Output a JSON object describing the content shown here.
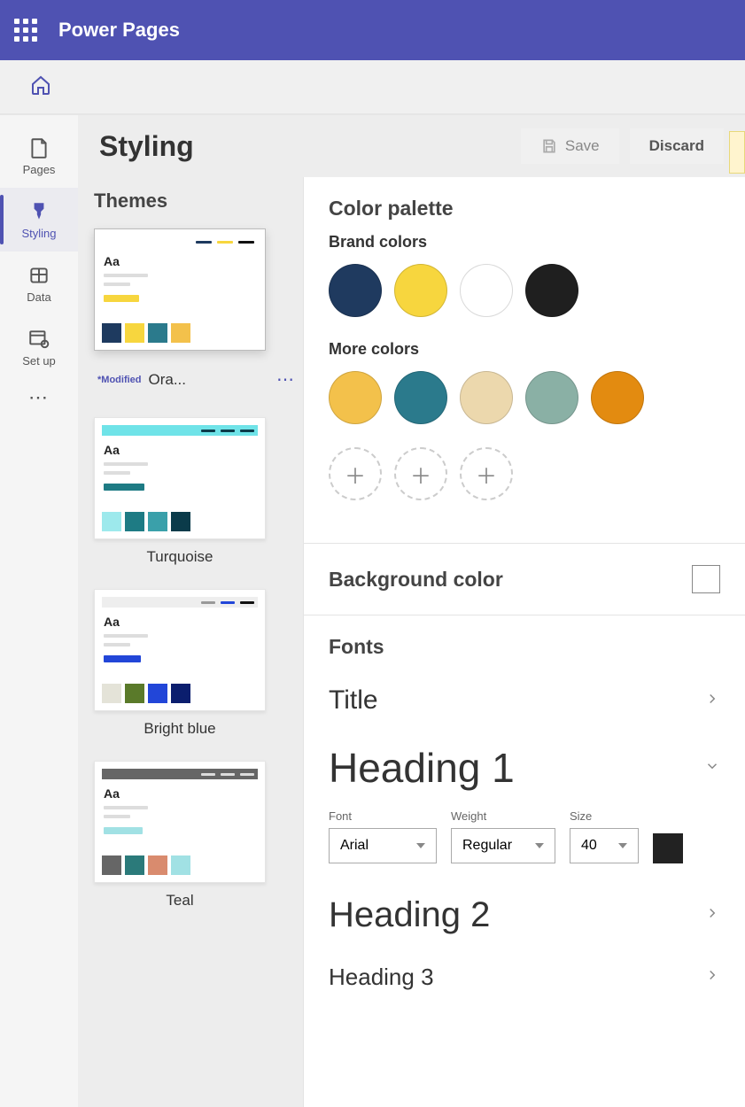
{
  "app": {
    "title": "Power Pages"
  },
  "rail": [
    {
      "label": "Pages"
    },
    {
      "label": "Styling"
    },
    {
      "label": "Data"
    },
    {
      "label": "Set up"
    }
  ],
  "header": {
    "title": "Styling",
    "save": "Save",
    "discard": "Discard"
  },
  "themes": {
    "title": "Themes",
    "modified": "*Modified",
    "items": [
      {
        "name": "Ora..."
      },
      {
        "name": "Turquoise"
      },
      {
        "name": "Bright blue"
      },
      {
        "name": "Teal"
      }
    ]
  },
  "palette": {
    "title": "Color palette",
    "brand_label": "Brand colors",
    "brand": [
      "#1f3a5f",
      "#f7d63e",
      "#ffffff",
      "#1f1f1f"
    ],
    "more_label": "More colors",
    "more": [
      "#f3c14b",
      "#2b7a8c",
      "#ecd8ad",
      "#8ab0a5",
      "#e38b10"
    ]
  },
  "background": {
    "title": "Background color",
    "value": "#ffffff"
  },
  "fonts": {
    "title": "Fonts",
    "items": [
      {
        "name": "Title"
      },
      {
        "name": "Heading 1"
      },
      {
        "name": "Heading 2"
      },
      {
        "name": "Heading 3"
      }
    ],
    "controls": {
      "font_label": "Font",
      "font_value": "Arial",
      "weight_label": "Weight",
      "weight_value": "Regular",
      "size_label": "Size",
      "size_value": "40",
      "color_value": "#222222"
    }
  }
}
